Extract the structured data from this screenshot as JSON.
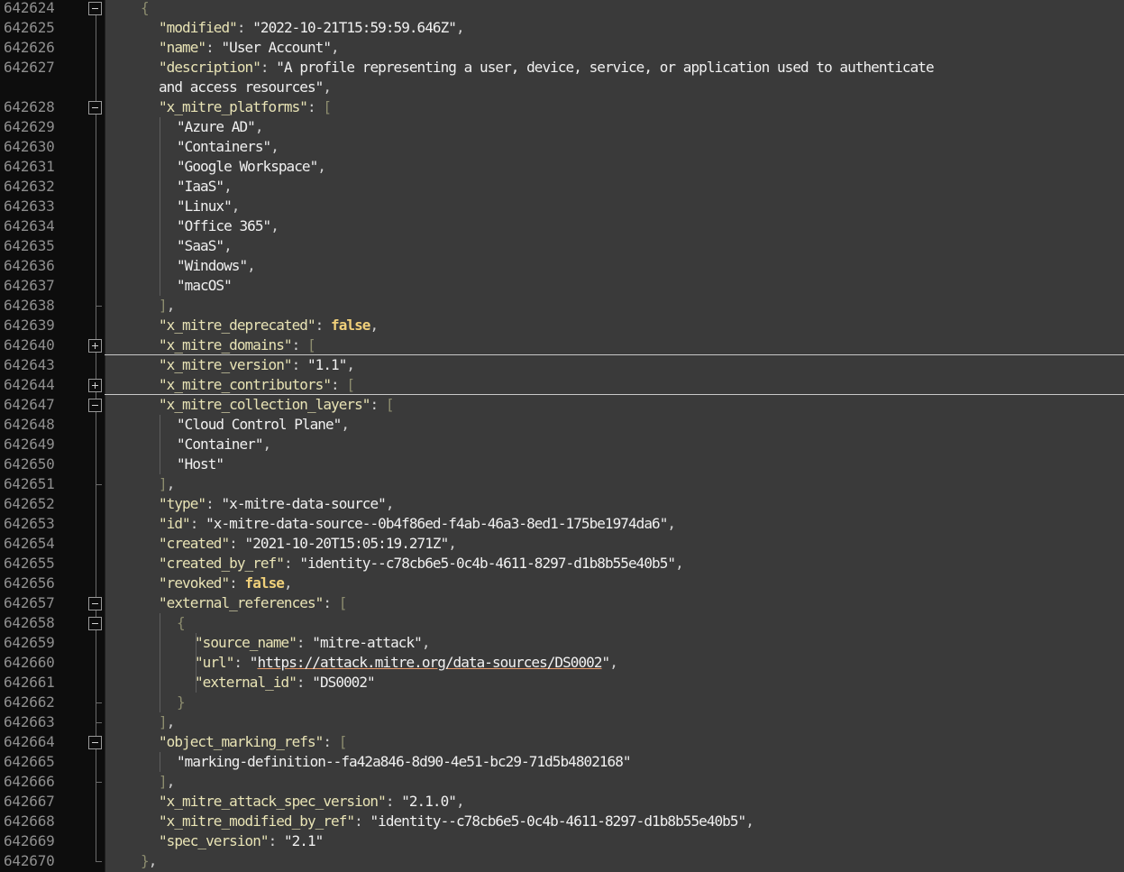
{
  "gutter": {
    "line_numbers": [
      "642624",
      "642625",
      "642626",
      "642627",
      "",
      "642628",
      "642629",
      "642630",
      "642631",
      "642632",
      "642633",
      "642634",
      "642635",
      "642636",
      "642637",
      "642638",
      "642639",
      "642640",
      "642643",
      "642644",
      "642647",
      "642648",
      "642649",
      "642650",
      "642651",
      "642652",
      "642653",
      "642654",
      "642655",
      "642656",
      "642657",
      "642658",
      "642659",
      "642660",
      "642661",
      "642662",
      "642663",
      "642664",
      "642665",
      "642666",
      "642667",
      "642668",
      "642669",
      "642670"
    ]
  },
  "editor": {
    "lines": [
      {
        "i": 2,
        "t": [
          [
            "b",
            "{"
          ]
        ]
      },
      {
        "i": 3,
        "t": [
          [
            "k",
            "\"modified\""
          ],
          [
            "p",
            ": "
          ],
          [
            "s",
            "\"2022-10-21T15:59:59.646Z\""
          ],
          [
            "p",
            ","
          ]
        ]
      },
      {
        "i": 3,
        "t": [
          [
            "k",
            "\"name\""
          ],
          [
            "p",
            ": "
          ],
          [
            "s",
            "\"User Account\""
          ],
          [
            "p",
            ","
          ]
        ]
      },
      {
        "i": 3,
        "t": [
          [
            "k",
            "\"description\""
          ],
          [
            "p",
            ": "
          ],
          [
            "s",
            "\"A profile representing a user, device, service, or application used to authenticate"
          ]
        ]
      },
      {
        "i": 3,
        "t": [
          [
            "s",
            "and access resources\""
          ],
          [
            "p",
            ","
          ]
        ]
      },
      {
        "i": 3,
        "t": [
          [
            "k",
            "\"x_mitre_platforms\""
          ],
          [
            "p",
            ": "
          ],
          [
            "b",
            "["
          ]
        ]
      },
      {
        "i": 4,
        "t": [
          [
            "s",
            "\"Azure AD\""
          ],
          [
            "p",
            ","
          ]
        ]
      },
      {
        "i": 4,
        "t": [
          [
            "s",
            "\"Containers\""
          ],
          [
            "p",
            ","
          ]
        ]
      },
      {
        "i": 4,
        "t": [
          [
            "s",
            "\"Google Workspace\""
          ],
          [
            "p",
            ","
          ]
        ]
      },
      {
        "i": 4,
        "t": [
          [
            "s",
            "\"IaaS\""
          ],
          [
            "p",
            ","
          ]
        ]
      },
      {
        "i": 4,
        "t": [
          [
            "s",
            "\"Linux\""
          ],
          [
            "p",
            ","
          ]
        ]
      },
      {
        "i": 4,
        "t": [
          [
            "s",
            "\"Office 365\""
          ],
          [
            "p",
            ","
          ]
        ]
      },
      {
        "i": 4,
        "t": [
          [
            "s",
            "\"SaaS\""
          ],
          [
            "p",
            ","
          ]
        ]
      },
      {
        "i": 4,
        "t": [
          [
            "s",
            "\"Windows\""
          ],
          [
            "p",
            ","
          ]
        ]
      },
      {
        "i": 4,
        "t": [
          [
            "s",
            "\"macOS\""
          ]
        ]
      },
      {
        "i": 3,
        "t": [
          [
            "b",
            "]"
          ],
          [
            "p",
            ","
          ]
        ]
      },
      {
        "i": 3,
        "t": [
          [
            "k",
            "\"x_mitre_deprecated\""
          ],
          [
            "p",
            ": "
          ],
          [
            "kw",
            "false"
          ],
          [
            "p",
            ","
          ]
        ]
      },
      {
        "i": 3,
        "t": [
          [
            "k",
            "\"x_mitre_domains\""
          ],
          [
            "p",
            ": "
          ],
          [
            "b",
            "["
          ]
        ]
      },
      {
        "i": 3,
        "t": [
          [
            "k",
            "\"x_mitre_version\""
          ],
          [
            "p",
            ": "
          ],
          [
            "s",
            "\"1.1\""
          ],
          [
            "p",
            ","
          ]
        ]
      },
      {
        "i": 3,
        "t": [
          [
            "k",
            "\"x_mitre_contributors\""
          ],
          [
            "p",
            ": "
          ],
          [
            "b",
            "["
          ]
        ]
      },
      {
        "i": 3,
        "t": [
          [
            "k",
            "\"x_mitre_collection_layers\""
          ],
          [
            "p",
            ": "
          ],
          [
            "b",
            "["
          ]
        ]
      },
      {
        "i": 4,
        "t": [
          [
            "s",
            "\"Cloud Control Plane\""
          ],
          [
            "p",
            ","
          ]
        ]
      },
      {
        "i": 4,
        "t": [
          [
            "s",
            "\"Container\""
          ],
          [
            "p",
            ","
          ]
        ]
      },
      {
        "i": 4,
        "t": [
          [
            "s",
            "\"Host\""
          ]
        ]
      },
      {
        "i": 3,
        "t": [
          [
            "b",
            "]"
          ],
          [
            "p",
            ","
          ]
        ]
      },
      {
        "i": 3,
        "t": [
          [
            "k",
            "\"type\""
          ],
          [
            "p",
            ": "
          ],
          [
            "s",
            "\"x-mitre-data-source\""
          ],
          [
            "p",
            ","
          ]
        ]
      },
      {
        "i": 3,
        "t": [
          [
            "k",
            "\"id\""
          ],
          [
            "p",
            ": "
          ],
          [
            "s",
            "\"x-mitre-data-source--0b4f86ed-f4ab-46a3-8ed1-175be1974da6\""
          ],
          [
            "p",
            ","
          ]
        ]
      },
      {
        "i": 3,
        "t": [
          [
            "k",
            "\"created\""
          ],
          [
            "p",
            ": "
          ],
          [
            "s",
            "\"2021-10-20T15:05:19.271Z\""
          ],
          [
            "p",
            ","
          ]
        ]
      },
      {
        "i": 3,
        "t": [
          [
            "k",
            "\"created_by_ref\""
          ],
          [
            "p",
            ": "
          ],
          [
            "s",
            "\"identity--c78cb6e5-0c4b-4611-8297-d1b8b55e40b5\""
          ],
          [
            "p",
            ","
          ]
        ]
      },
      {
        "i": 3,
        "t": [
          [
            "k",
            "\"revoked\""
          ],
          [
            "p",
            ": "
          ],
          [
            "kw",
            "false"
          ],
          [
            "p",
            ","
          ]
        ]
      },
      {
        "i": 3,
        "t": [
          [
            "k",
            "\"external_references\""
          ],
          [
            "p",
            ": "
          ],
          [
            "b",
            "["
          ]
        ]
      },
      {
        "i": 4,
        "t": [
          [
            "b",
            "{"
          ]
        ]
      },
      {
        "i": 5,
        "t": [
          [
            "k",
            "\"source_name\""
          ],
          [
            "p",
            ": "
          ],
          [
            "s",
            "\"mitre-attack\""
          ],
          [
            "p",
            ","
          ]
        ]
      },
      {
        "i": 5,
        "t": [
          [
            "k",
            "\"url\""
          ],
          [
            "p",
            ": "
          ],
          [
            "s",
            "\""
          ],
          [
            "u",
            "https://attack.mitre.org/data-sources/DS0002"
          ],
          [
            "s",
            "\""
          ],
          [
            "p",
            ","
          ]
        ]
      },
      {
        "i": 5,
        "t": [
          [
            "k",
            "\"external_id\""
          ],
          [
            "p",
            ": "
          ],
          [
            "s",
            "\"DS0002\""
          ]
        ]
      },
      {
        "i": 4,
        "t": [
          [
            "b",
            "}"
          ]
        ]
      },
      {
        "i": 3,
        "t": [
          [
            "b",
            "]"
          ],
          [
            "p",
            ","
          ]
        ]
      },
      {
        "i": 3,
        "t": [
          [
            "k",
            "\"object_marking_refs\""
          ],
          [
            "p",
            ": "
          ],
          [
            "b",
            "["
          ]
        ]
      },
      {
        "i": 4,
        "t": [
          [
            "s",
            "\"marking-definition--fa42a846-8d90-4e51-bc29-71d5b4802168\""
          ]
        ]
      },
      {
        "i": 3,
        "t": [
          [
            "b",
            "]"
          ],
          [
            "p",
            ","
          ]
        ]
      },
      {
        "i": 3,
        "t": [
          [
            "k",
            "\"x_mitre_attack_spec_version\""
          ],
          [
            "p",
            ": "
          ],
          [
            "s",
            "\"2.1.0\""
          ],
          [
            "p",
            ","
          ]
        ]
      },
      {
        "i": 3,
        "t": [
          [
            "k",
            "\"x_mitre_modified_by_ref\""
          ],
          [
            "p",
            ": "
          ],
          [
            "s",
            "\"identity--c78cb6e5-0c4b-4611-8297-d1b8b55e40b5\""
          ],
          [
            "p",
            ","
          ]
        ]
      },
      {
        "i": 3,
        "t": [
          [
            "k",
            "\"spec_version\""
          ],
          [
            "p",
            ": "
          ],
          [
            "s",
            "\"2.1\""
          ]
        ]
      },
      {
        "i": 2,
        "t": [
          [
            "b",
            "}"
          ],
          [
            "p",
            ","
          ]
        ]
      }
    ]
  },
  "colors": {
    "background": "#3a3a3a",
    "gutter": "#0d0d0d",
    "key": "#e8e3b5",
    "string": "#f0f0f0",
    "bracket": "#8c8c6e",
    "keyword": "#f0d07a"
  }
}
